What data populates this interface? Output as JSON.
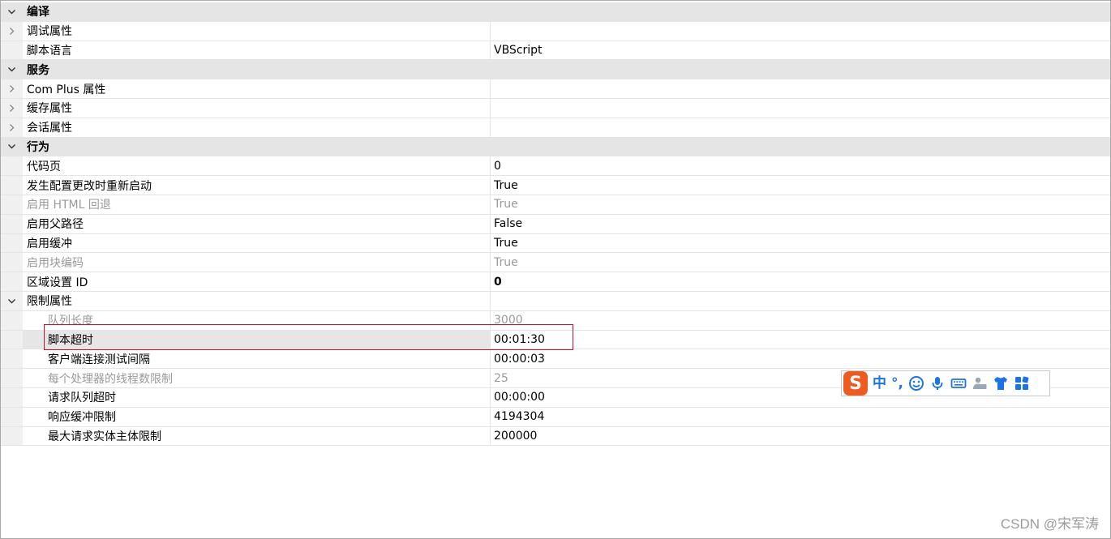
{
  "property_grid": {
    "rows": [
      {
        "kind": "category",
        "expanded": true,
        "name": "编译",
        "value": ""
      },
      {
        "kind": "property",
        "expandable": true,
        "name": "调试属性",
        "value": ""
      },
      {
        "kind": "property",
        "name": "脚本语言",
        "value": "VBScript"
      },
      {
        "kind": "category",
        "expanded": true,
        "name": "服务",
        "value": ""
      },
      {
        "kind": "property",
        "expandable": true,
        "name": "Com Plus 属性",
        "value": ""
      },
      {
        "kind": "property",
        "expandable": true,
        "name": "缓存属性",
        "value": ""
      },
      {
        "kind": "property",
        "expandable": true,
        "name": "会话属性",
        "value": ""
      },
      {
        "kind": "category",
        "expanded": true,
        "name": "行为",
        "value": ""
      },
      {
        "kind": "property",
        "name": "代码页",
        "value": "0"
      },
      {
        "kind": "property",
        "name": "发生配置更改时重新启动",
        "value": "True"
      },
      {
        "kind": "property",
        "disabled": true,
        "name": "启用 HTML 回退",
        "value": "True"
      },
      {
        "kind": "property",
        "name": "启用父路径",
        "value": "False"
      },
      {
        "kind": "property",
        "name": "启用缓冲",
        "value": "True"
      },
      {
        "kind": "property",
        "disabled": true,
        "name": "启用块编码",
        "value": "True"
      },
      {
        "kind": "property",
        "bold_value": true,
        "name": "区域设置 ID",
        "value": "0"
      },
      {
        "kind": "property",
        "expanded": true,
        "name": "限制属性",
        "value": ""
      },
      {
        "kind": "sub",
        "disabled": true,
        "name": "队列长度",
        "value": "3000"
      },
      {
        "kind": "sub",
        "selected": true,
        "name": "脚本超时",
        "value": "00:01:30"
      },
      {
        "kind": "sub",
        "name": "客户端连接测试间隔",
        "value": "00:00:03"
      },
      {
        "kind": "sub",
        "disabled": true,
        "name": "每个处理器的线程数限制",
        "value": "25"
      },
      {
        "kind": "sub",
        "name": "请求队列超时",
        "value": "00:00:00"
      },
      {
        "kind": "sub",
        "name": "响应缓冲限制",
        "value": "4194304"
      },
      {
        "kind": "sub",
        "name": "最大请求实体主体限制",
        "value": "200000"
      }
    ]
  },
  "ime_toolbar": {
    "logo": "S",
    "mode_label": "中",
    "punct_label": "°,",
    "icons": [
      "smiley-icon",
      "microphone-icon",
      "keyboard-icon",
      "user-icon",
      "shirt-icon",
      "grid-icon"
    ]
  },
  "watermark": "CSDN @宋军涛",
  "colors": {
    "category_bg": "#e5e5e5",
    "highlight_box": "#c8102e",
    "ime_accent": "#1a74e8",
    "ime_logo_bg": "#f05a1f"
  }
}
